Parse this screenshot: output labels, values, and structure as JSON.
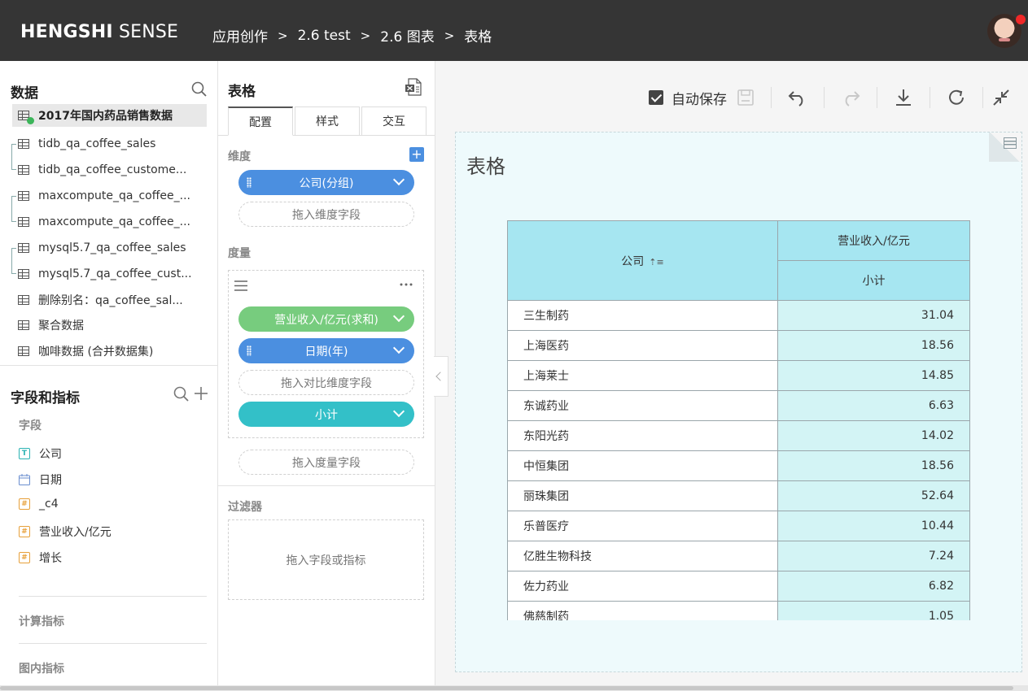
{
  "header": {
    "logo_bold": "HENGSHI",
    "logo_rest": " SENSE",
    "breadcrumb": [
      "应用创作",
      "2.6 test",
      "2.6 图表",
      "表格"
    ],
    "separator": ">"
  },
  "data_panel": {
    "title": "数据",
    "datasets": [
      {
        "label": "2017年国内药品销售数据",
        "active": true
      },
      {
        "label": "tidb_qa_coffee_sales"
      },
      {
        "label": "tidb_qa_coffee_custome..."
      },
      {
        "label": "maxcompute_qa_coffee_..."
      },
      {
        "label": "maxcompute_qa_coffee_..."
      },
      {
        "label": "mysql5.7_qa_coffee_sales"
      },
      {
        "label": "mysql5.7_qa_coffee_cust..."
      },
      {
        "label": "删除别名：qa_coffee_sal..."
      },
      {
        "label": "聚合数据"
      },
      {
        "label": "咖啡数据 (合并数据集)"
      }
    ]
  },
  "fields_panel": {
    "title": "字段和指标",
    "fields_label": "字段",
    "fields": [
      {
        "label": "公司",
        "type": "T"
      },
      {
        "label": "日期",
        "type": "date"
      },
      {
        "label": "_c4",
        "type": "#"
      },
      {
        "label": "营业收入/亿元",
        "type": "#"
      },
      {
        "label": "增长",
        "type": "#"
      }
    ],
    "calc_label": "计算指标",
    "inner_label": "图内指标"
  },
  "config": {
    "title": "表格",
    "tabs": [
      "配置",
      "样式",
      "交互"
    ],
    "dimension_label": "维度",
    "dimension_pill": "公司(分组)",
    "dimension_drop": "拖入维度字段",
    "measure_label": "度量",
    "measure_pill": "营业收入/亿元(求和)",
    "date_pill": "日期(年)",
    "compare_drop": "拖入对比维度字段",
    "subtotal_pill": "小计",
    "measure_drop": "拖入度量字段",
    "filter_label": "过滤器",
    "filter_drop": "拖入字段或指标"
  },
  "toolbar": {
    "autosave_label": "自动保存"
  },
  "chart": {
    "title": "表格",
    "col_company": "公司",
    "col_revenue": "营业收入/亿元",
    "col_subtotal": "小计",
    "rows": [
      {
        "name": "三生制药",
        "value": "31.04"
      },
      {
        "name": "上海医药",
        "value": "18.56"
      },
      {
        "name": "上海莱士",
        "value": "14.85"
      },
      {
        "name": "东诚药业",
        "value": "6.63"
      },
      {
        "name": "东阳光药",
        "value": "14.02"
      },
      {
        "name": "中恒集团",
        "value": "18.56"
      },
      {
        "name": "丽珠集团",
        "value": "52.64"
      },
      {
        "name": "乐普医疗",
        "value": "10.44"
      },
      {
        "name": "亿胜生物科技",
        "value": "7.24"
      },
      {
        "name": "佐力药业",
        "value": "6.82"
      },
      {
        "name": "佛慈制药",
        "value": "1.05"
      }
    ]
  }
}
